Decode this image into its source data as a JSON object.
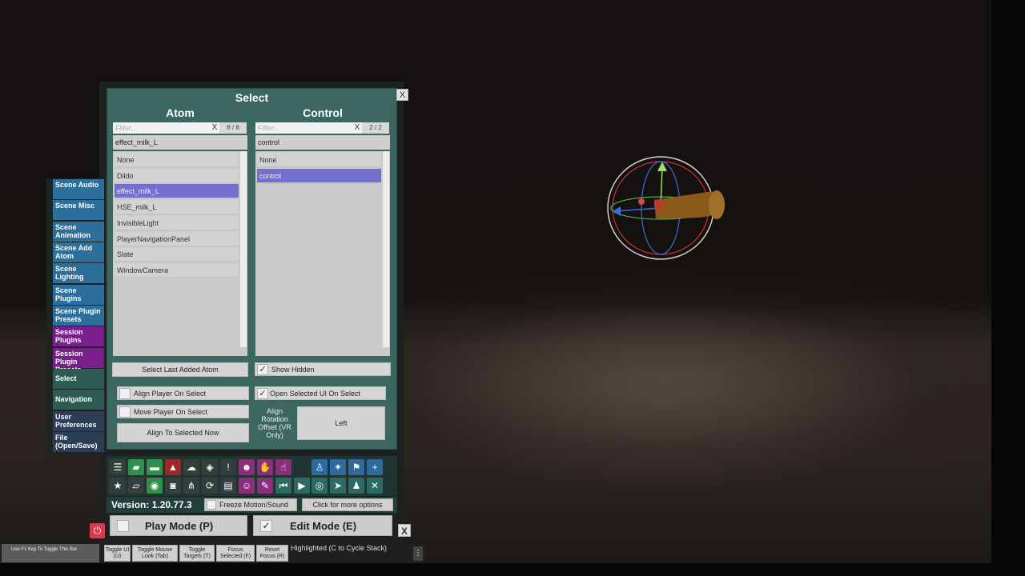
{
  "select_panel": {
    "title": "Select",
    "close_label": "X",
    "atom": {
      "title": "Atom",
      "filter_placeholder": "Filter...",
      "filter_clear": "X",
      "count": "8 / 8",
      "current": "effect_milk_L",
      "items": [
        "None",
        "Dildo",
        "effect_milk_L",
        "HSE_milk_L",
        "InvisibleLight",
        "PlayerNavigationPanel",
        "Slate",
        "WindowCamera"
      ],
      "selected_index": 2
    },
    "control": {
      "title": "Control",
      "filter_placeholder": "Filter...",
      "filter_clear": "X",
      "count": "2 / 2",
      "current": "control",
      "items": [
        "None",
        "control"
      ],
      "selected_index": 1
    },
    "select_last_added": "Select Last Added Atom",
    "show_hidden": {
      "label": "Show Hidden",
      "checked": true
    },
    "align_player": {
      "label": "Align Player On Select",
      "checked": false
    },
    "open_ui": {
      "label": "Open Selected UI On Select",
      "checked": true
    },
    "move_player": {
      "label": "Move Player On Select",
      "checked": false
    },
    "align_now": "Align To Selected Now",
    "align_rotation_label": "Align Rotation Offset (VR Only)",
    "align_rotation_value": "Left"
  },
  "side_tabs": [
    {
      "label": "Scene Audio",
      "color": "blue"
    },
    {
      "label": "Scene Misc",
      "color": "blue"
    },
    {
      "label": "Scene Animation",
      "color": "blue"
    },
    {
      "label": "Scene Add Atom",
      "color": "blue"
    },
    {
      "label": "Scene Lighting",
      "color": "blue"
    },
    {
      "label": "Scene Plugins",
      "color": "blue"
    },
    {
      "label": "Scene Plugin Presets",
      "color": "blue"
    },
    {
      "label": "Session Plugins",
      "color": "purple"
    },
    {
      "label": "Session Plugin Presets",
      "color": "purple"
    },
    {
      "label": "Select",
      "color": "teal"
    },
    {
      "label": "Navigation",
      "color": "teal"
    },
    {
      "label": "User Preferences",
      "color": "navy"
    },
    {
      "label": "File (Open/Save)",
      "color": "navy"
    }
  ],
  "toolbar": {
    "version": "Version: 1.20.77.3",
    "freeze_motion": "Freeze Motion/Sound",
    "more_options": "Click for more options",
    "play_mode": {
      "label": "Play Mode (P)",
      "checked": false
    },
    "edit_mode": {
      "label": "Edit Mode (E)",
      "checked": true
    },
    "close_label": "X",
    "power_icon": "⏻"
  },
  "status_bar": {
    "f1_hint": "Use F1 Key To Toggle This Bar",
    "buttons": [
      "Toggle UI (U)",
      "Toggle Mouse Look (Tab)",
      "Toggle Targets (T)",
      "Focus Selected (F)",
      "Reset Focus (R)"
    ],
    "highlighted": "Highlighted (C to Cycle Stack)",
    "menu_icon": "⋮"
  },
  "icons_row1": [
    {
      "name": "menu-icon",
      "glyph": "☰",
      "color": "dark"
    },
    {
      "name": "open-scene-icon",
      "glyph": "▰",
      "color": "green"
    },
    {
      "name": "folder-icon",
      "glyph": "▬",
      "color": "green"
    },
    {
      "name": "save-icon",
      "glyph": "▲",
      "color": "red"
    },
    {
      "name": "cloud-icon",
      "glyph": "☁",
      "color": "dark"
    },
    {
      "name": "package-icon",
      "glyph": "◈",
      "color": "dark"
    },
    {
      "name": "alert-icon",
      "glyph": "!",
      "color": "dark"
    },
    {
      "name": "person-settings-icon",
      "glyph": "☻",
      "color": "purple"
    },
    {
      "name": "hand-icon",
      "glyph": "✋",
      "color": "purple"
    },
    {
      "name": "touch-icon",
      "glyph": "☝",
      "color": "purple"
    },
    {
      "name": "user-icon",
      "glyph": "♙",
      "color": "blue"
    },
    {
      "name": "unity-icon",
      "glyph": "✦",
      "color": "blue"
    },
    {
      "name": "flag-icon",
      "glyph": "⚑",
      "color": "blue"
    },
    {
      "name": "add-icon",
      "glyph": "+",
      "color": "blue"
    }
  ],
  "icons_row2": [
    {
      "name": "star-icon",
      "glyph": "★",
      "color": "dark"
    },
    {
      "name": "folder-open-icon",
      "glyph": "▱",
      "color": "dark"
    },
    {
      "name": "screenshot-icon",
      "glyph": "◉",
      "color": "green"
    },
    {
      "name": "camera-icon",
      "glyph": "◙",
      "color": "dark"
    },
    {
      "name": "share-icon",
      "glyph": "⋔",
      "color": "dark"
    },
    {
      "name": "refresh-package-icon",
      "glyph": "⟳",
      "color": "dark"
    },
    {
      "name": "document-icon",
      "glyph": "▤",
      "color": "dark"
    },
    {
      "name": "person-alert-icon",
      "glyph": "☺",
      "color": "purple"
    },
    {
      "name": "wrench-icon",
      "glyph": "✎",
      "color": "purple"
    },
    {
      "name": "skip-back-icon",
      "glyph": "⏮",
      "color": "teal"
    },
    {
      "name": "play-icon",
      "glyph": "▶",
      "color": "teal"
    },
    {
      "name": "target-icon",
      "glyph": "◎",
      "color": "teal"
    },
    {
      "name": "pointer-icon",
      "glyph": "➤",
      "color": "teal"
    },
    {
      "name": "people-icon",
      "glyph": "♟",
      "color": "teal"
    },
    {
      "name": "tools-icon",
      "glyph": "✕",
      "color": "teal"
    }
  ]
}
